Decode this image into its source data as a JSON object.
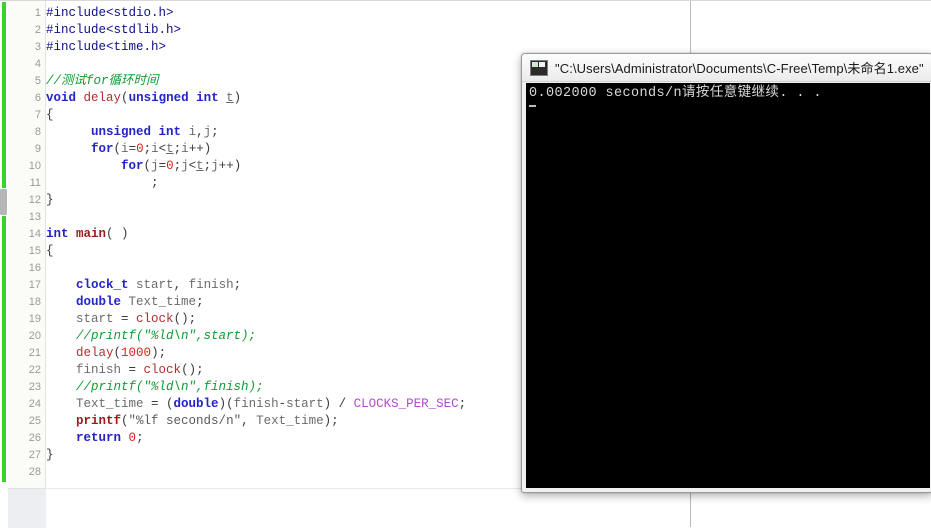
{
  "editor": {
    "name": "code-editor",
    "gutter_lines": [
      "1",
      "2",
      "3",
      "4",
      "5",
      "6",
      "7",
      "8",
      "9",
      "10",
      "11",
      "12",
      "13",
      "14",
      "15",
      "16",
      "17",
      "18",
      "19",
      "20",
      "21",
      "22",
      "23",
      "24",
      "25",
      "26",
      "27",
      "28"
    ],
    "code_lines": [
      {
        "n": 1,
        "text": "#include<stdio.h>"
      },
      {
        "n": 2,
        "text": "#include<stdlib.h>"
      },
      {
        "n": 3,
        "text": "#include<time.h>"
      },
      {
        "n": 4,
        "text": ""
      },
      {
        "n": 5,
        "text": "//测试for循环时间"
      },
      {
        "n": 6,
        "text": "void delay(unsigned int t)"
      },
      {
        "n": 7,
        "text": "{"
      },
      {
        "n": 8,
        "text": "      unsigned int i,j;"
      },
      {
        "n": 9,
        "text": "      for(i=0;i<t;i++)"
      },
      {
        "n": 10,
        "text": "          for(j=0;j<t;j++)"
      },
      {
        "n": 11,
        "text": "              ;"
      },
      {
        "n": 12,
        "text": "}"
      },
      {
        "n": 13,
        "text": ""
      },
      {
        "n": 14,
        "text": "int main( )"
      },
      {
        "n": 15,
        "text": "{"
      },
      {
        "n": 16,
        "text": ""
      },
      {
        "n": 17,
        "text": "    clock_t start, finish;"
      },
      {
        "n": 18,
        "text": "    double Text_time;"
      },
      {
        "n": 19,
        "text": "    start = clock();"
      },
      {
        "n": 20,
        "text": "    //printf(\"%ld\\n\",start);"
      },
      {
        "n": 21,
        "text": "    delay(1000);"
      },
      {
        "n": 22,
        "text": "    finish = clock();"
      },
      {
        "n": 23,
        "text": "    //printf(\"%ld\\n\",finish);"
      },
      {
        "n": 24,
        "text": "    Text_time = (double)(finish-start) / CLOCKS_PER_SEC;"
      },
      {
        "n": 25,
        "text": "    printf(\"%lf seconds/n\", Text_time);"
      },
      {
        "n": 26,
        "text": "    return 0;"
      },
      {
        "n": 27,
        "text": "}"
      },
      {
        "n": 28,
        "text": ""
      }
    ]
  },
  "console": {
    "title": "\"C:\\Users\\Administrator\\Documents\\C-Free\\Temp\\未命名1.exe\"",
    "icon": "console-icon",
    "output": "0.002000 seconds/n请按任意键继续. . ."
  },
  "colors": {
    "keyword": "#2323c8",
    "comment": "#0f9c32",
    "number": "#e01b1b",
    "function": "#b03030",
    "macro": "#b04bc9",
    "preprocessor": "#0e0e8a",
    "change_bar": "#3ad32b",
    "console_background": "#000000",
    "console_text": "#d8d8d8"
  }
}
